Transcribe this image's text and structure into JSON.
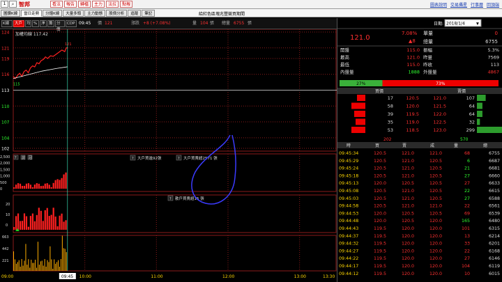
{
  "toolbar": {
    "selector": "1",
    "stock_name": "智邦",
    "buttons": [
      "看法",
      "報告",
      "轉檔",
      "主力",
      "法拉",
      "點報"
    ],
    "links": [
      "圖表說明",
      "交易攝星",
      "行事曆",
      "回頂端"
    ]
  },
  "tabs": {
    "items": [
      "圖鑽K線",
      "當日走勢",
      "分鐘K線",
      "大量多頭",
      "主力動態",
      "股價分析",
      "追蹤",
      "筆記"
    ],
    "active_index": 1,
    "center_title": "給紅色區塊兆豐競買期間"
  },
  "infobar": {
    "mode_buttons": [
      "K線",
      "大戶",
      "均",
      "%",
      "淨",
      "籌",
      "分價",
      "CDP"
    ],
    "active_mode_index": 1,
    "time": "09:45",
    "price_label": "價",
    "price": "121",
    "change_label": "漲跌",
    "change": "+8 (+7.08%)",
    "vol_label": "量",
    "vol": "104",
    "vol_unit": "張",
    "total_label": "總量",
    "total": "6755",
    "total_unit": "張"
  },
  "chart": {
    "ma_label": "加權均線 117.42",
    "price_ticks": [
      "124",
      "121",
      "119",
      "116",
      "113",
      "110",
      "107",
      "104",
      "102"
    ],
    "price_tick_colors": [
      "#ff3030",
      "#ff3030",
      "#ff3030",
      "#ff3030",
      "#ffffff",
      "#30ff30",
      "#30ff30",
      "#30ff30",
      "#ffffff"
    ],
    "high_label": "121",
    "low_label": "115",
    "panel2_icons": [
      "?",
      "説",
      "冠"
    ],
    "panel2_ticks": [
      "2,500",
      "2,000",
      "1,500",
      "1,000",
      "500",
      "0"
    ],
    "annotation_a": "大戶買進92張",
    "annotation_b": "大戶買賣超2571 張",
    "annotation_c": "散戶買賣超15 張",
    "panel3_ticks": [
      "20",
      "10",
      "0"
    ],
    "panel4_ticks": [
      "663",
      "442",
      "221"
    ],
    "time_ticks": [
      "09:00",
      "10:00",
      "11:00",
      "12:00",
      "13:00",
      "13:30"
    ],
    "cursor_time": "09:45",
    "colors": {
      "up": "#ff2020",
      "down": "#20d020",
      "grid": "#8b1a1a",
      "ink": "#3b3bff"
    }
  },
  "quote": {
    "date_label": "日期:",
    "date": "2018/1/4",
    "price": "121.0",
    "pct": "7.08%",
    "arrow": "▲8",
    "vol_label": "單量",
    "vol": "0",
    "total_label": "總量",
    "total": "6755",
    "stats": [
      {
        "label": "開盤",
        "value": "115.0",
        "label2": "振幅",
        "value2": "5.3%"
      },
      {
        "label": "最高",
        "value": "121.0",
        "label2": "昨量",
        "value2": "7569"
      },
      {
        "label": "最低",
        "value": "115.0",
        "label2": "昨收",
        "value2": "113"
      },
      {
        "label": "內盤量",
        "value": "1888",
        "label2": "外盤量",
        "value2": "4867"
      }
    ],
    "ratio_green": "27%",
    "ratio_red": "73%",
    "ratio_green_frac": 0.27
  },
  "orderbook": {
    "buy_header": "買價",
    "sell_header": "賣價",
    "rows": [
      {
        "bvol": "17",
        "bid": "120.5",
        "ask": "121.0",
        "avol": "107"
      },
      {
        "bvol": "58",
        "bid": "120.0",
        "ask": "121.5",
        "avol": "64"
      },
      {
        "bvol": "39",
        "bid": "119.5",
        "ask": "122.0",
        "avol": "64"
      },
      {
        "bvol": "35",
        "bid": "119.0",
        "ask": "122.5",
        "avol": "32"
      },
      {
        "bvol": "53",
        "bid": "118.5",
        "ask": "123.0",
        "avol": "299"
      }
    ],
    "bid_levels": [
      0.3,
      0.5,
      0.4,
      0.35,
      0.5
    ],
    "ask_levels": [
      0.35,
      0.22,
      0.22,
      0.12,
      1.0
    ],
    "buy_total": "202",
    "sell_total": "570"
  },
  "ticks": {
    "headers": [
      "時",
      "買",
      "賣",
      "成",
      "量",
      "總"
    ],
    "rows": [
      {
        "t": "09:45:34",
        "b": "120.5",
        "s": "121.0",
        "p": "121.0",
        "v": "68",
        "total": "6755",
        "vc": "#ff3030"
      },
      {
        "t": "09:45:29",
        "b": "120.5",
        "s": "121.0",
        "p": "120.5",
        "v": "6",
        "total": "6687",
        "vc": "#30ff30"
      },
      {
        "t": "09:45:24",
        "b": "120.5",
        "s": "121.0",
        "p": "120.5",
        "v": "21",
        "total": "6681",
        "vc": "#30ff30"
      },
      {
        "t": "09:45:18",
        "b": "120.5",
        "s": "121.0",
        "p": "120.5",
        "v": "27",
        "total": "6660",
        "vc": "#30ff30"
      },
      {
        "t": "09:45:13",
        "b": "120.0",
        "s": "120.5",
        "p": "120.5",
        "v": "27",
        "total": "6633",
        "vc": "#ff3030"
      },
      {
        "t": "09:45:08",
        "b": "120.5",
        "s": "121.0",
        "p": "120.5",
        "v": "22",
        "total": "6615",
        "vc": "#30ff30"
      },
      {
        "t": "09:45:03",
        "b": "120.5",
        "s": "121.0",
        "p": "120.5",
        "v": "27",
        "total": "6588",
        "vc": "#30ff30"
      },
      {
        "t": "09:44:58",
        "b": "120.5",
        "s": "121.0",
        "p": "121.0",
        "v": "22",
        "total": "6561",
        "vc": "#ff3030"
      },
      {
        "t": "09:44:53",
        "b": "120.0",
        "s": "120.5",
        "p": "120.5",
        "v": "69",
        "total": "6539",
        "vc": "#ff3030"
      },
      {
        "t": "09:44:48",
        "b": "120.0",
        "s": "120.5",
        "p": "120.0",
        "v": "165",
        "total": "6480",
        "vc": "#30ff30"
      },
      {
        "t": "09:44:43",
        "b": "119.5",
        "s": "120.0",
        "p": "120.0",
        "v": "101",
        "total": "6315",
        "vc": "#ff3030"
      },
      {
        "t": "09:44:37",
        "b": "119.5",
        "s": "120.0",
        "p": "120.0",
        "v": "13",
        "total": "6214",
        "vc": "#ff3030"
      },
      {
        "t": "09:44:32",
        "b": "119.5",
        "s": "120.0",
        "p": "120.0",
        "v": "33",
        "total": "6201",
        "vc": "#ff3030"
      },
      {
        "t": "09:44:27",
        "b": "119.5",
        "s": "120.0",
        "p": "120.0",
        "v": "22",
        "total": "6168",
        "vc": "#ff3030"
      },
      {
        "t": "09:44:22",
        "b": "119.5",
        "s": "120.0",
        "p": "120.0",
        "v": "27",
        "total": "6146",
        "vc": "#ff3030"
      },
      {
        "t": "09:44:17",
        "b": "119.5",
        "s": "120.0",
        "p": "120.0",
        "v": "104",
        "total": "6119",
        "vc": "#ff3030"
      },
      {
        "t": "09:44:12",
        "b": "119.5",
        "s": "120.0",
        "p": "120.0",
        "v": "10",
        "total": "6015",
        "vc": "#ff3030"
      }
    ]
  }
}
